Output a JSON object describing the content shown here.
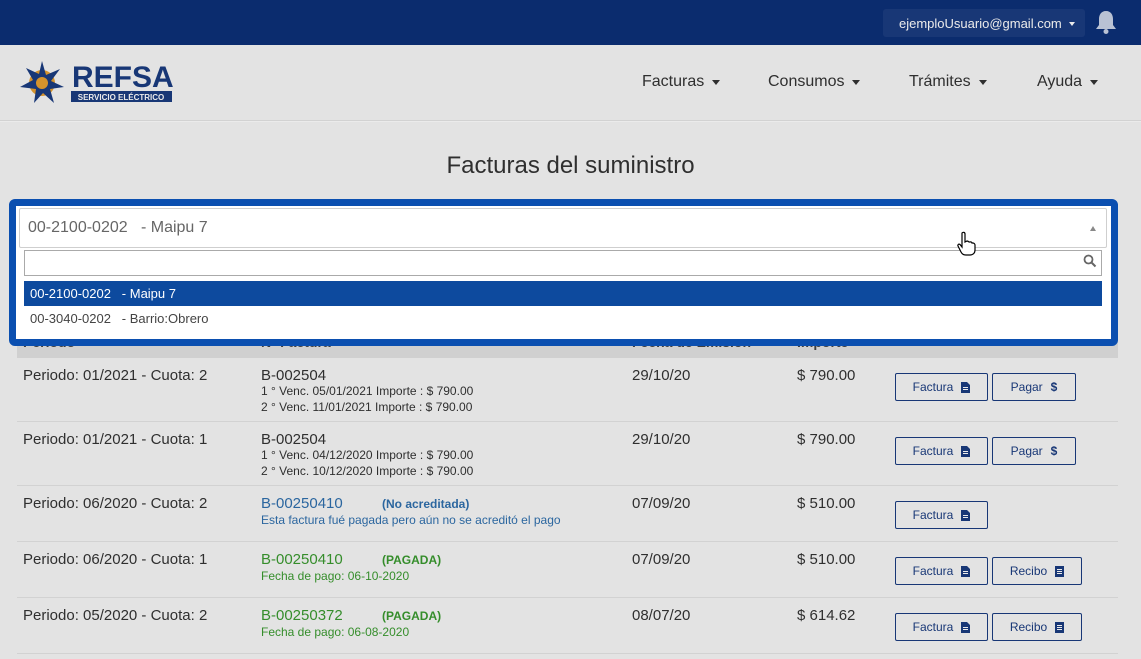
{
  "header": {
    "user_email": "ejemploUsuario@gmail.com",
    "bell_icon": "bell-icon"
  },
  "brand": {
    "name": "REFSA",
    "tagline": "SERVICIO ELÉCTRICO"
  },
  "nav": {
    "items": [
      {
        "label": "Facturas"
      },
      {
        "label": "Consumos"
      },
      {
        "label": "Trámites"
      },
      {
        "label": "Ayuda"
      }
    ]
  },
  "page": {
    "title": "Facturas del suministro"
  },
  "supply_select": {
    "selected": "00-2100-0202   - Maipu 7",
    "search_value": "",
    "options": [
      {
        "label": "00-2100-0202   - Maipu 7",
        "selected": true
      },
      {
        "label": "00-3040-0202   - Barrio:Obrero",
        "selected": false
      }
    ]
  },
  "table": {
    "headers": [
      "Periodo",
      "Nº Factura",
      "Fecha de Emisión",
      "Importe"
    ],
    "rows": [
      {
        "period": "Periodo: 01/2021 - Cuota: 2",
        "invoice": "B-002504",
        "status": "",
        "line1": "1 ° Venc. 05/01/2021 Importe : $ 790.00",
        "line2": "2 ° Venc. 11/01/2021 Importe : $ 790.00",
        "date": "29/10/20",
        "amount": "$ 790.00",
        "buttons": [
          "Factura",
          "Pagar"
        ]
      },
      {
        "period": "Periodo: 01/2021 - Cuota: 1",
        "invoice": "B-002504",
        "status": "",
        "line1": "1 ° Venc. 04/12/2020 Importe : $ 790.00",
        "line2": "2 ° Venc. 10/12/2020 Importe : $ 790.00",
        "date": "29/10/20",
        "amount": "$ 790.00",
        "buttons": [
          "Factura",
          "Pagar"
        ]
      },
      {
        "period": "Periodo: 06/2020 - Cuota: 2",
        "invoice": "B-00250410",
        "status": "(No acreditada)",
        "line1": "Esta factura fué pagada pero aún no se acreditó el pago",
        "line2": "",
        "date": "07/09/20",
        "amount": "$ 510.00",
        "buttons": [
          "Factura"
        ]
      },
      {
        "period": "Periodo: 06/2020 - Cuota: 1",
        "invoice": "B-00250410",
        "status": "(PAGADA)",
        "line1": "Fecha de pago: 06-10-2020",
        "line2": "",
        "date": "07/09/20",
        "amount": "$ 510.00",
        "buttons": [
          "Factura",
          "Recibo"
        ]
      },
      {
        "period": "Periodo: 05/2020 - Cuota: 2",
        "invoice": "B-00250372",
        "status": "(PAGADA)",
        "line1": "Fecha de pago: 06-08-2020",
        "line2": "",
        "date": "08/07/20",
        "amount": "$ 614.62",
        "buttons": [
          "Factura",
          "Recibo"
        ]
      }
    ]
  },
  "colors": {
    "topbar": "#0d3078",
    "accent": "#0b4fb0",
    "paid": "#3a9a2f",
    "pending": "#2f6fad"
  }
}
